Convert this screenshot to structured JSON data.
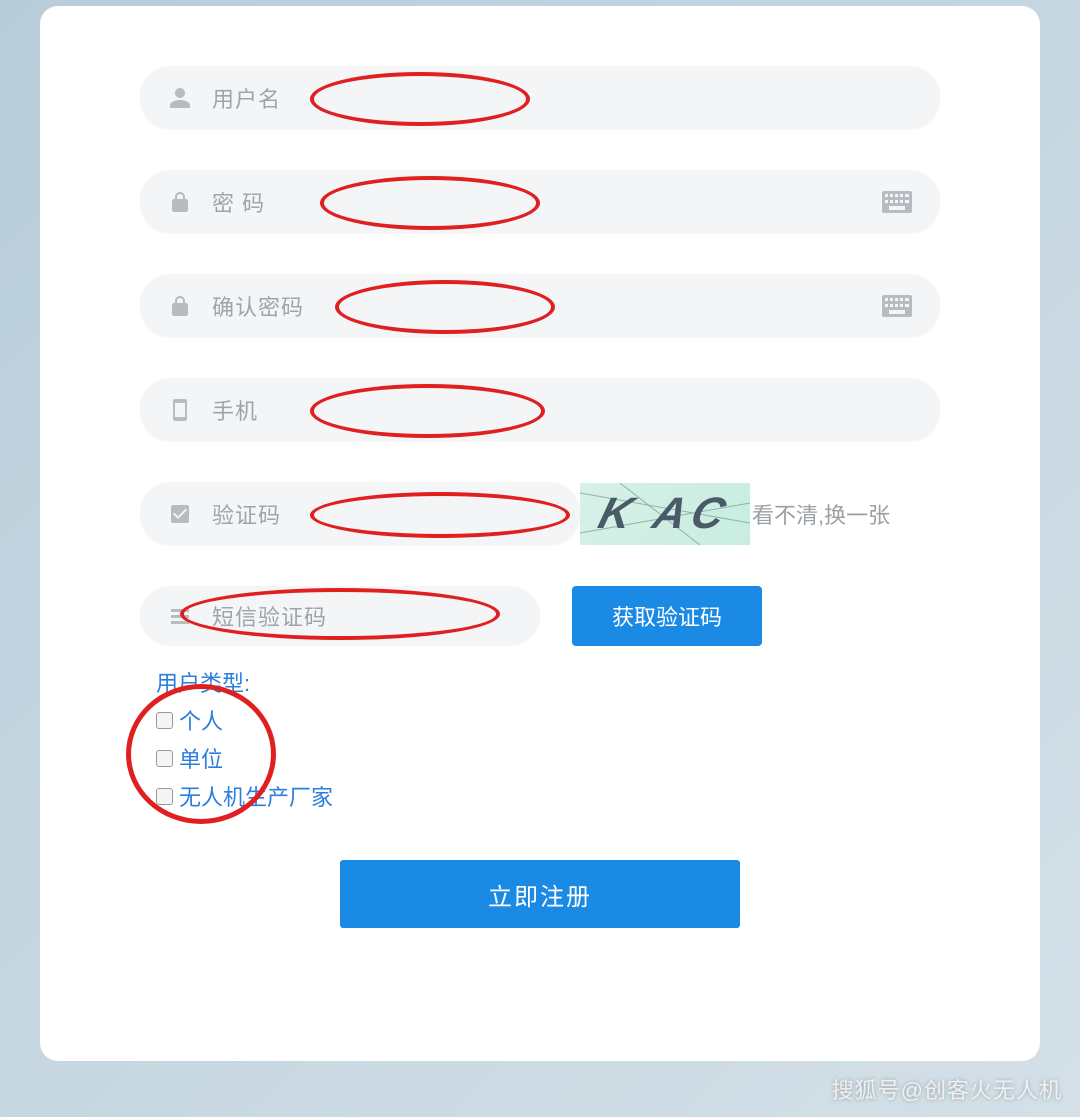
{
  "fields": {
    "username_label": "用户名",
    "password_label": "密  码",
    "confirm_password_label": "确认密码",
    "phone_label": "手机",
    "captcha_label": "验证码",
    "captcha_value": "K AC",
    "refresh_captcha": "看不清,换一张",
    "sms_code_label": "短信验证码"
  },
  "buttons": {
    "get_sms_code": "获取验证码",
    "register": "立即注册"
  },
  "user_type": {
    "title": "用户类型:",
    "options": {
      "personal": "个人",
      "organization": "单位",
      "manufacturer": "无人机生产厂家"
    }
  },
  "watermark": "搜狐号@创客火无人机"
}
